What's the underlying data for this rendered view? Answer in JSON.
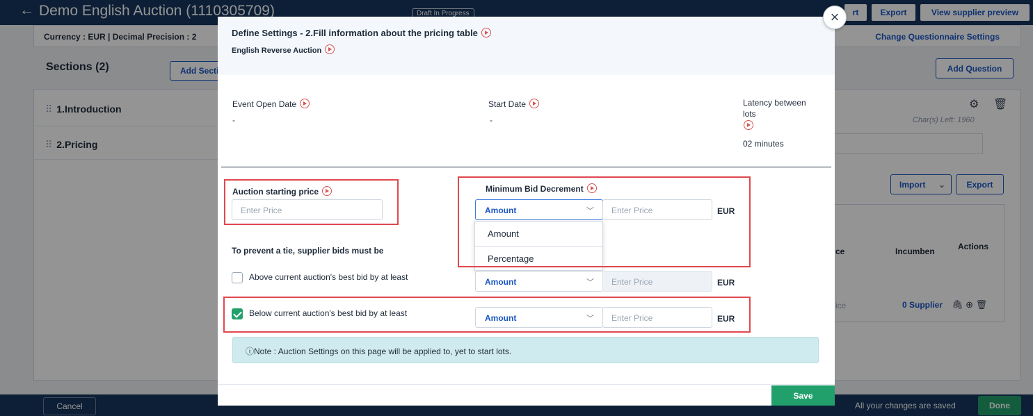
{
  "background": {
    "back_arrow": "←",
    "title": "Demo English Auction  (1110305709)",
    "status_badge": "Draft In Progress",
    "header_buttons": {
      "partial": "rt",
      "export": "Export",
      "preview": "View supplier preview"
    },
    "currency_line": "Currency : EUR | Decimal Precision : 2",
    "change_settings": "Change Questionnaire Settings",
    "sections_title": "Sections (2)",
    "add_section": "Add Section",
    "add_question": "Add Question",
    "sections": [
      {
        "label": "1.Introduction"
      },
      {
        "label": "2.Pricing"
      }
    ],
    "chars_left": "Char(s) Left: 1960",
    "import_label": "Import",
    "export_label": "Export",
    "table": {
      "headers": [
        "ce",
        "Incumben",
        "Actions"
      ],
      "cells": [
        "ice"
      ],
      "supplier_link": "0 Suppliers"
    },
    "footer": {
      "cancel": "Cancel",
      "saved_msg": "All your changes are saved",
      "done": "Done"
    }
  },
  "modal": {
    "title": "Define Settings - 2.Fill information about the pricing table",
    "subtitle": "English Reverse Auction",
    "close": "×",
    "event_open_date": {
      "label": "Event Open Date",
      "value": "-"
    },
    "start_date": {
      "label": "Start Date",
      "value": "-"
    },
    "latency": {
      "label_line1": "Latency between",
      "label_line2": "lots",
      "value": "02 minutes"
    },
    "auction_start_price": {
      "label": "Auction starting price",
      "placeholder": "Enter Price"
    },
    "min_bid_decrement": {
      "label": "Minimum Bid Decrement",
      "type_value": "Amount",
      "placeholder": "Enter Price",
      "unit": "EUR",
      "options": [
        "Amount",
        "Percentage"
      ]
    },
    "tie_prevention": {
      "label": "To prevent a tie, supplier bids must be",
      "above": {
        "label": "Above current auction's best bid by at least",
        "checked": false,
        "type_value": "Amount",
        "placeholder": "Enter Price",
        "unit": "EUR"
      },
      "below": {
        "label": "Below current auction's best bid by at least",
        "checked": true,
        "type_value": "Amount",
        "placeholder": "Enter Price",
        "unit": "EUR"
      }
    },
    "note": "ⓘNote : Auction Settings on this page will be applied to, yet to start lots.",
    "save": "Save"
  },
  "colors": {
    "primary": "#1a56c4",
    "success": "#22a06b",
    "highlight": "#e0484e",
    "header_bg": "#17365d"
  },
  "icons": [
    "back-arrow-icon",
    "close-icon",
    "help-video-icon",
    "chevron-down-icon",
    "gear-icon",
    "trash-icon",
    "drag-handle-icon",
    "paperclip-icon",
    "add-circle-icon",
    "checkbox-icon"
  ]
}
